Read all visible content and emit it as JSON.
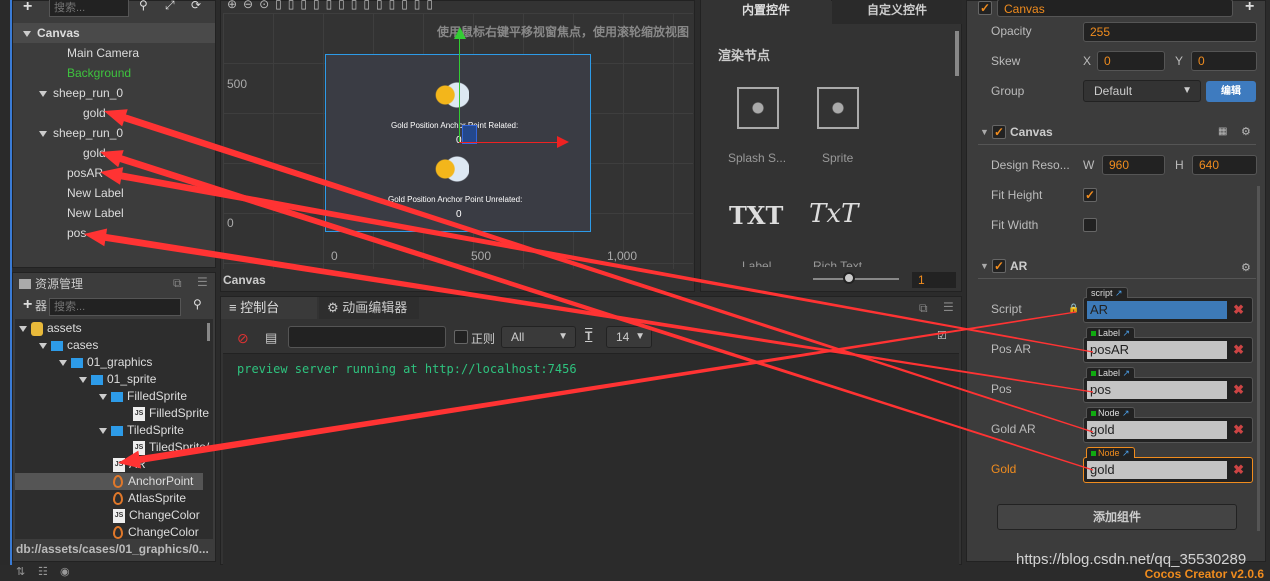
{
  "hierarchy": {
    "search_placeholder": "搜索...",
    "items": [
      {
        "label": "Canvas",
        "level": 0,
        "expanded": true
      },
      {
        "label": "Main Camera",
        "level": 1
      },
      {
        "label": "Background",
        "level": 1,
        "color": "#3ec43e"
      },
      {
        "label": "sheep_run_0",
        "level": 1,
        "expanded": true
      },
      {
        "label": "gold",
        "level": 2
      },
      {
        "label": "sheep_run_0",
        "level": 1,
        "expanded": true
      },
      {
        "label": "gold",
        "level": 2
      },
      {
        "label": "posAR",
        "level": 1
      },
      {
        "label": "New Label",
        "level": 1
      },
      {
        "label": "New Label",
        "level": 1
      },
      {
        "label": "pos",
        "level": 1
      }
    ]
  },
  "scene": {
    "hint": "使用鼠标右键平移视窗焦点，使用滚轮缩放视图",
    "y_ticks": [
      "500",
      "0"
    ],
    "x_ticks": [
      "0",
      "500",
      "1,000"
    ],
    "label_related": "Gold Position Anchor Point Related:",
    "value_related": "0",
    "label_unrelated": "Gold Position Anchor Point Unrelated:",
    "value_unrelated": "0",
    "footer": "Canvas"
  },
  "widgets": {
    "tabs": [
      "内置控件",
      "自定义控件"
    ],
    "section": "渲染节点",
    "items": [
      "Splash S...",
      "Sprite",
      "Label",
      "Rich Text"
    ],
    "txt_icon": "TXT",
    "richtxt_icon": "TxT",
    "zoom_value": "1"
  },
  "assets": {
    "title": "资源管理器",
    "search_placeholder": "搜索...",
    "items": [
      {
        "label": "assets",
        "type": "root",
        "level": 0
      },
      {
        "label": "cases",
        "type": "folder",
        "level": 1
      },
      {
        "label": "01_graphics",
        "type": "folder",
        "level": 2
      },
      {
        "label": "01_sprite",
        "type": "folder",
        "level": 3
      },
      {
        "label": "FilledSprite",
        "type": "folder",
        "level": 4
      },
      {
        "label": "FilledSprite",
        "type": "js",
        "level": 5
      },
      {
        "label": "TiledSprite",
        "type": "folder",
        "level": 4
      },
      {
        "label": "TiledSprite/",
        "type": "js",
        "level": 5
      },
      {
        "label": "AR",
        "type": "js",
        "level": 4
      },
      {
        "label": "AnchorPoint",
        "type": "scene",
        "level": 4,
        "selected": true
      },
      {
        "label": "AtlasSprite",
        "type": "scene",
        "level": 4
      },
      {
        "label": "ChangeColor",
        "type": "js",
        "level": 4
      },
      {
        "label": "ChangeColor",
        "type": "scene",
        "level": 4
      }
    ],
    "path": "db://assets/cases/01_graphics/0..."
  },
  "console": {
    "tabs": [
      "控制台",
      "动画编辑器"
    ],
    "regex_label": "正则",
    "level": "All",
    "font_size": "14",
    "log": "preview server running at http://localhost:7456"
  },
  "inspector": {
    "node_name": "Canvas",
    "opacity_label": "Opacity",
    "opacity": "255",
    "skew_label": "Skew",
    "skew_x": "0",
    "skew_y": "0",
    "x": "X",
    "y": "Y",
    "group_label": "Group",
    "group": "Default",
    "edit_button": "编辑",
    "canvas_comp": "Canvas",
    "design_label": "Design Reso...",
    "w": "W",
    "h": "H",
    "design_w": "960",
    "design_h": "640",
    "fit_height_label": "Fit Height",
    "fit_height": true,
    "fit_width_label": "Fit Width",
    "fit_width": false,
    "ar_comp": "AR",
    "props": [
      {
        "label": "Script",
        "tag": "script",
        "value": "AR"
      },
      {
        "label": "Pos AR",
        "tag": "Label",
        "value": "posAR"
      },
      {
        "label": "Pos",
        "tag": "Label",
        "value": "pos"
      },
      {
        "label": "Gold AR",
        "tag": "Node",
        "value": "gold"
      },
      {
        "label": "Gold",
        "tag": "Node",
        "value": "gold",
        "highlight": true
      }
    ],
    "add_component": "添加组件"
  },
  "watermark": "https://blog.csdn.net/qq_35530289",
  "version": "Cocos Creator v2.0.6",
  "colors": {
    "accent": "#f08c1e",
    "arrow": "#ff3333",
    "selection": "#2d9be8",
    "console_text": "#2ec27e"
  }
}
